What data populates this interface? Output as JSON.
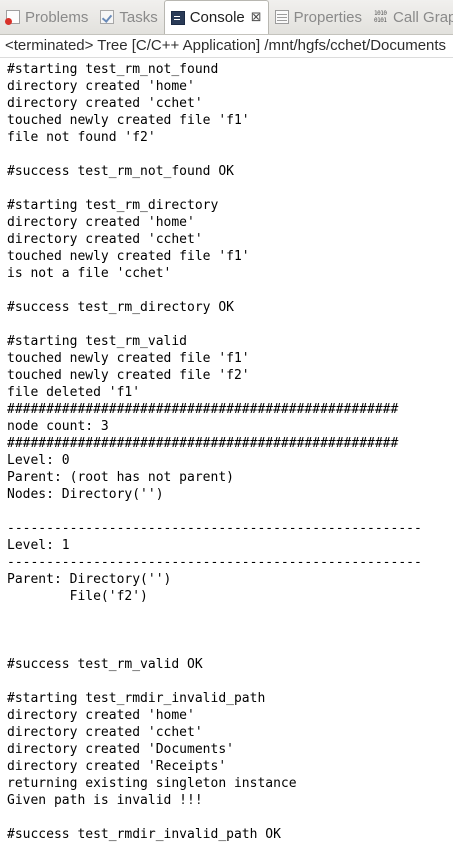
{
  "tabs": [
    {
      "label": "Problems",
      "icon": "problems-icon",
      "active": false
    },
    {
      "label": "Tasks",
      "icon": "tasks-icon",
      "active": false
    },
    {
      "label": "Console",
      "icon": "console-icon",
      "active": true,
      "close": "⊠"
    },
    {
      "label": "Properties",
      "icon": "properties-icon",
      "active": false
    },
    {
      "label": "Call Graph",
      "icon": "call-graph-icon",
      "icon_text": "1010\n0101",
      "active": false
    }
  ],
  "status": {
    "text": "<terminated> Tree [C/C++ Application] /mnt/hgfs/cchet/Documents"
  },
  "console": {
    "lines": [
      "#starting test_rm_not_found",
      "directory created 'home'",
      "directory created 'cchet'",
      "touched newly created file 'f1'",
      "file not found 'f2'",
      "",
      "#success test_rm_not_found OK",
      "",
      "#starting test_rm_directory",
      "directory created 'home'",
      "directory created 'cchet'",
      "touched newly created file 'f1'",
      "is not a file 'cchet'",
      "",
      "#success test_rm_directory OK",
      "",
      "#starting test_rm_valid",
      "touched newly created file 'f1'",
      "touched newly created file 'f2'",
      "file deleted 'f1'",
      "##################################################",
      "node count: 3",
      "##################################################",
      "Level: 0",
      "Parent: (root has not parent)",
      "Nodes: Directory('')",
      "",
      "-----------------------------------------------------",
      "Level: 1",
      "-----------------------------------------------------",
      "Parent: Directory('')",
      "        File('f2')",
      "",
      "",
      "",
      "#success test_rm_valid OK",
      "",
      "#starting test_rmdir_invalid_path",
      "directory created 'home'",
      "directory created 'cchet'",
      "directory created 'Documents'",
      "directory created 'Receipts'",
      "returning existing singleton instance",
      "Given path is invalid !!!",
      "",
      "#success test_rmdir_invalid_path OK"
    ]
  }
}
